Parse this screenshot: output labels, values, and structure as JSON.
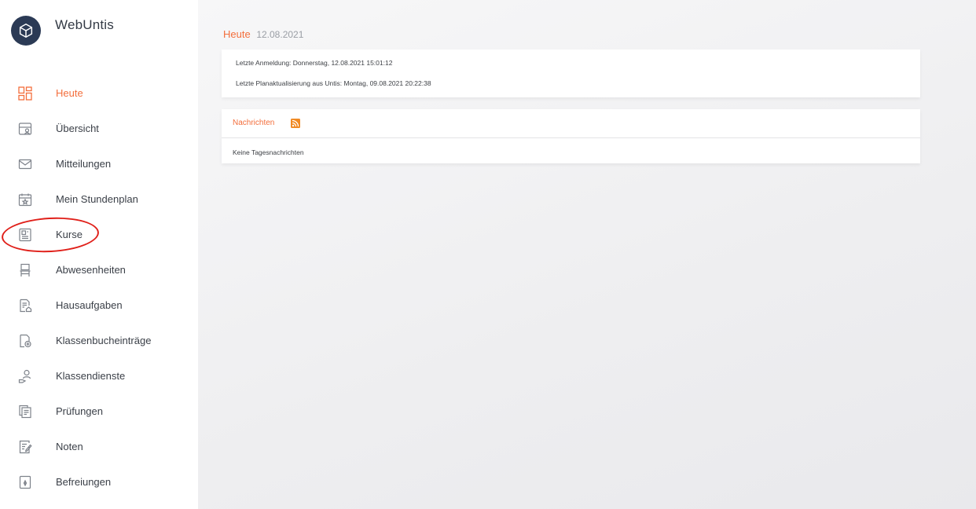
{
  "app": {
    "name": "WebUntis",
    "logo_icon": "cube-icon"
  },
  "sidebar": {
    "items": [
      {
        "label": "Heute",
        "icon": "dashboard-grid-icon",
        "active": true
      },
      {
        "label": "Übersicht",
        "icon": "overview-icon",
        "active": false
      },
      {
        "label": "Mitteilungen",
        "icon": "mail-icon",
        "active": false
      },
      {
        "label": "Mein Stundenplan",
        "icon": "calendar-star-icon",
        "active": false
      },
      {
        "label": "Kurse",
        "icon": "course-icon",
        "active": false
      },
      {
        "label": "Abwesenheiten",
        "icon": "chair-icon",
        "active": false
      },
      {
        "label": "Hausaufgaben",
        "icon": "homework-icon",
        "active": false
      },
      {
        "label": "Klassenbucheinträge",
        "icon": "classbook-entry-icon",
        "active": false
      },
      {
        "label": "Klassendienste",
        "icon": "class-service-icon",
        "active": false
      },
      {
        "label": "Prüfungen",
        "icon": "exams-icon",
        "active": false
      },
      {
        "label": "Noten",
        "icon": "grades-icon",
        "active": false
      },
      {
        "label": "Befreiungen",
        "icon": "exemption-icon",
        "active": false
      }
    ],
    "highlighted_item": "Kurse",
    "highlight_color": "#e0201a"
  },
  "main": {
    "heading": {
      "title": "Heute",
      "date": "12.08.2021"
    },
    "info_card": {
      "last_login": "Letzte Anmeldung: Donnerstag, 12.08.2021 15:01:12",
      "last_update": "Letzte Planaktualisierung aus Untis: Montag, 09.08.2021 20:22:38"
    },
    "news_card": {
      "title": "Nachrichten",
      "icon": "rss-icon",
      "body": "Keine Tagesnachrichten"
    }
  },
  "colors": {
    "accent": "#f36e3c",
    "logo_bg": "#2b3a55",
    "text": "#3a3f47",
    "rss": "#f08a24"
  }
}
